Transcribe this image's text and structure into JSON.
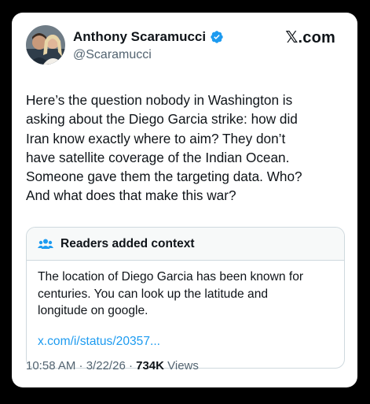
{
  "author": {
    "name": "Anthony Scaramucci",
    "handle": "@Scaramucci",
    "verified": true
  },
  "brand": "𝕏.com",
  "tweet": {
    "lines": [
      "Here’s the question nobody in Washington is",
      "asking about the Diego Garcia strike: how did",
      "Iran know exactly where to aim? They don’t",
      "have satellite coverage of the Indian Ocean.",
      "Someone gave them the targeting data. Who?",
      "And what does that make this war?"
    ]
  },
  "community_note": {
    "title": "Readers added context",
    "lines": [
      "The location of Diego Garcia has been known for",
      "centuries. You can look up the latitude and",
      "longitude on google."
    ],
    "link": "x.com/i/status/20357..."
  },
  "meta": {
    "time": "10:58 AM",
    "date": "3/22/26",
    "separator": " · ",
    "views_count": "734K",
    "views_label": " Views"
  },
  "colors": {
    "verified_badge": "#1d9bf0",
    "link": "#1d9bf0",
    "secondary_text": "#536471"
  }
}
